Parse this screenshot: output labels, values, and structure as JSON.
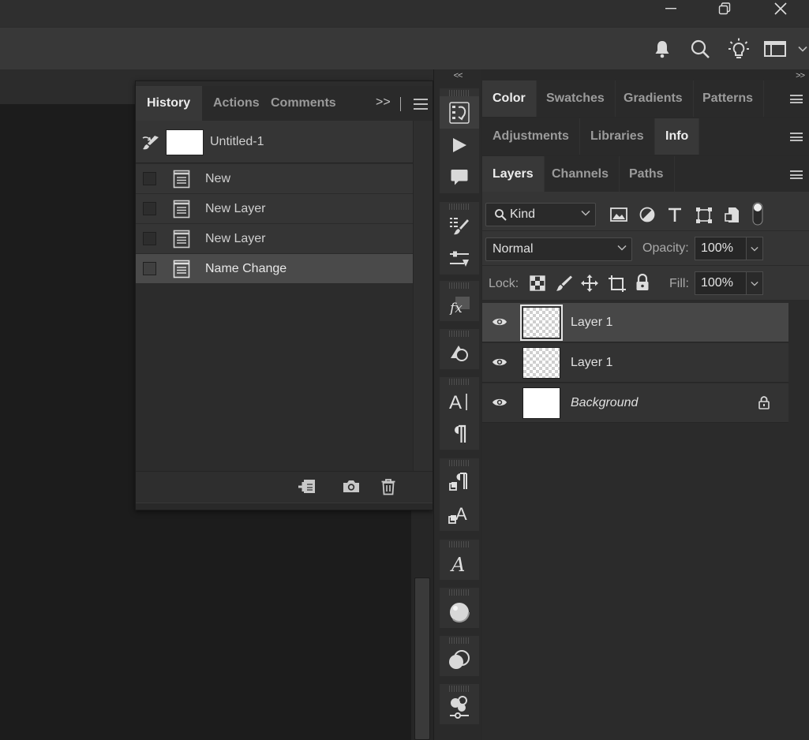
{
  "window": {
    "controls": [
      "minimize",
      "restore",
      "close"
    ]
  },
  "history_panel": {
    "tabs": [
      {
        "label": "History",
        "active": true
      },
      {
        "label": "Actions",
        "active": false
      },
      {
        "label": "Comments",
        "active": false
      }
    ],
    "overflow_label": ">>",
    "snapshot": {
      "name": "Untitled-1"
    },
    "states": [
      {
        "label": "New",
        "selected": false
      },
      {
        "label": "New Layer",
        "selected": false
      },
      {
        "label": "New Layer",
        "selected": false
      },
      {
        "label": "Name Change",
        "selected": true
      }
    ]
  },
  "dock_collapse_label": "<<",
  "right_collapse_label": ">>",
  "color_group": {
    "tabs": [
      {
        "label": "Color",
        "active": true
      },
      {
        "label": "Swatches",
        "active": false
      },
      {
        "label": "Gradients",
        "active": false
      },
      {
        "label": "Patterns",
        "active": false
      }
    ]
  },
  "adjust_group": {
    "tabs": [
      {
        "label": "Adjustments",
        "active": false
      },
      {
        "label": "Libraries",
        "active": false
      },
      {
        "label": "Info",
        "active": true
      }
    ]
  },
  "layers_group": {
    "tabs": [
      {
        "label": "Layers",
        "active": true
      },
      {
        "label": "Channels",
        "active": false
      },
      {
        "label": "Paths",
        "active": false
      }
    ],
    "filter_kind": "Kind",
    "blend_mode": "Normal",
    "opacity_label": "Opacity:",
    "opacity_value": "100%",
    "lock_label": "Lock:",
    "fill_label": "Fill:",
    "fill_value": "100%",
    "layers": [
      {
        "name": "Layer 1",
        "selected": true,
        "thumb": "transparent",
        "locked": false
      },
      {
        "name": "Layer 1",
        "selected": false,
        "thumb": "transparent",
        "locked": false
      },
      {
        "name": "Background",
        "selected": false,
        "thumb": "white",
        "locked": true,
        "italic": true
      }
    ]
  }
}
